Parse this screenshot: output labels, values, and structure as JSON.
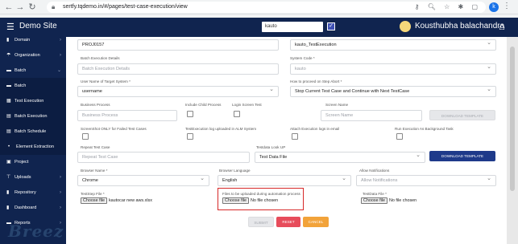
{
  "browser": {
    "url": "sertfy.tqdemo.in/#/pages/test-case-execution/view",
    "profile_initial": "k"
  },
  "header": {
    "brand": "Demo Site",
    "project_value": "kauto",
    "user_name": "Kousthubha balachandra"
  },
  "sidebar": {
    "items": [
      {
        "label": "Domain"
      },
      {
        "label": "Organization"
      },
      {
        "label": "Batch"
      },
      {
        "label": "Batch"
      },
      {
        "label": "Test Execution"
      },
      {
        "label": "Batch Execution"
      },
      {
        "label": "Batch Schedule"
      },
      {
        "label": "Element Extraction"
      },
      {
        "label": "Project"
      },
      {
        "label": "Uploads"
      },
      {
        "label": "Repository"
      },
      {
        "label": "Dashboard"
      },
      {
        "label": "Reports"
      }
    ]
  },
  "form": {
    "project_value": "PROJ0157",
    "execution_value": "kauto_TestExecution",
    "batch_exec_label": "Batch Execution Details",
    "batch_exec_placeholder": "Batch Execution Details",
    "system_code_label": "System Code *",
    "system_code_value": "kauto",
    "target_user_label": "User Name of Target System *",
    "target_user_value": "username",
    "proceed_label": "How to proceed on Step Abort *",
    "proceed_value": "Stop Current Test Case and Continue with Next TestCase",
    "business_process_label": "Business Process",
    "business_process_placeholder": "Business Process",
    "include_child_label": "Include Child Process",
    "login_screen_label": "Login Screen Test",
    "screen_name_label": "Screen Name",
    "screen_name_placeholder": "Screen Name",
    "download_template_label": "DOWNLOAD TEMPLATE",
    "screenshot_label": "ScreenShot ONLY for Failed Test Cases",
    "alm_label": "TestExecution log uploaded in ALM System",
    "attach_logs_label": "Attach Execution logs in email",
    "background_label": "Run Execution As Background Task",
    "repeat_label": "Repeat Test Case",
    "repeat_placeholder": "Repeat Test Case",
    "testdata_lookup_label": "Testdata Look UP",
    "testdata_lookup_value": "Test Data File",
    "download_template_label2": "DOWNLOAD TEMPLATE",
    "browser_name_label": "Browser Name *",
    "browser_name_value": "Chrome",
    "browser_lang_label": "Browser Language",
    "browser_lang_value": "English",
    "allow_notif_label": "Allow Notifications",
    "allow_notif_placeholder": "Allow Notifications",
    "teststep_label": "TestStep File *",
    "choose_file": "Choose file",
    "teststep_file": "kautocar new aws.xlsx",
    "upload_label": "Files to be uploaded during automation process",
    "no_file": "No file chosen",
    "testdata_file_label": "TestData File *",
    "submit": "SUBMIT",
    "reset": "RESET",
    "cancel": "CANCEL"
  },
  "footer": {
    "logo_text": "Breez"
  }
}
